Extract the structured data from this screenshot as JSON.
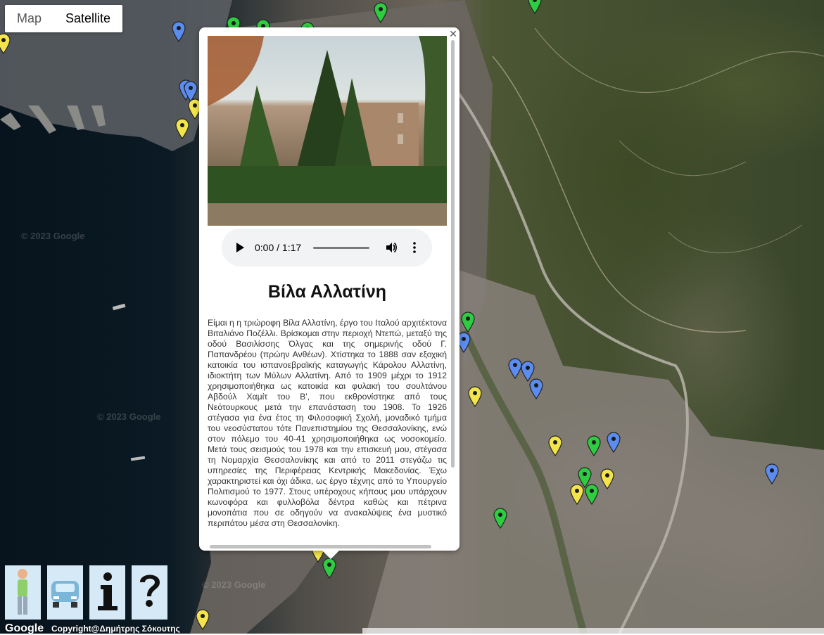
{
  "map_type": {
    "options": [
      {
        "label": "Map",
        "active": false
      },
      {
        "label": "Satellite",
        "active": true
      }
    ]
  },
  "watermark_text": "© 2023 Google",
  "marker_colors": {
    "green": "#2ecc40",
    "blue": "#5b8cf0",
    "yellow": "#f2e44a"
  },
  "info_window": {
    "close_icon": "close-icon",
    "audio": {
      "time": "0:00 / 1:17"
    },
    "title": "Βίλα Αλλατίνη",
    "description": "Είμαι η η τριώροφη Βίλα Αλλατίνη, έργο του Ιταλού αρχιτέκτονα Βιταλιάνο Ποζέλλι. Βρίσκομαι στην περιοχή Ντεπώ, μεταξύ της οδού Βασιλίσσης Όλγας και της σημερινής οδού Γ. Παπανδρέου (πρώην Ανθέων). Χτίστηκα το 1888 σαν εξοχική κατοικία του ισπανοεβραϊκής καταγωγής Κάρολου Αλλατίνη, ιδιοκτήτη των Μύλων Αλλατίνη. Από το 1909 μέχρι το 1912 χρησιμοποιήθηκα ως κατοικία και φυλακή του σουλτάνου Αβδούλ Χαμίτ του Β', που εκθρονίστηκε από τους Νεότουρκους μετά την επανάσταση του 1908. Το 1926 στέγασα για ένα έτος τη Φιλοσοφική Σχολή, μοναδικό τμήμα του νεοσύστατου τότε Πανεπιστημίου της Θεσσαλονίκης, ενώ στον πόλεμο του 40-41 χρησιμοποιήθηκα ως νοσοκομείο. Μετά τους σεισμούς του 1978 και την επισκευή μου, στέγασα τη Νομαρχία Θεσσαλονίκης και από το 2011 στεγάζω τις υπηρεσίες της Περιφέρειας Κεντρικής Μακεδονίας. Έχω χαρακτηριστεί και όχι άδικα, ως έργο τέχνης από το Υπουργείο Πολιτισμού το 1977. Στους υπέροχους κήπους μου υπάρχουν κωνοφόρα και φυλλοβόλα δέντρα καθώς και πέτρινα μονοπάτια που σε οδηγούν να ανακαλύψεις ένα μυστικό περιπάτου μέσα στη Θεσσαλονίκη."
  },
  "controls": [
    {
      "name": "walking-person-icon"
    },
    {
      "name": "car-icon"
    },
    {
      "name": "info-icon"
    },
    {
      "name": "help-question-icon"
    }
  ],
  "footer": {
    "google_logo": "Google",
    "copyright": "Copyright@Δημήτρης Σόκουτης"
  }
}
